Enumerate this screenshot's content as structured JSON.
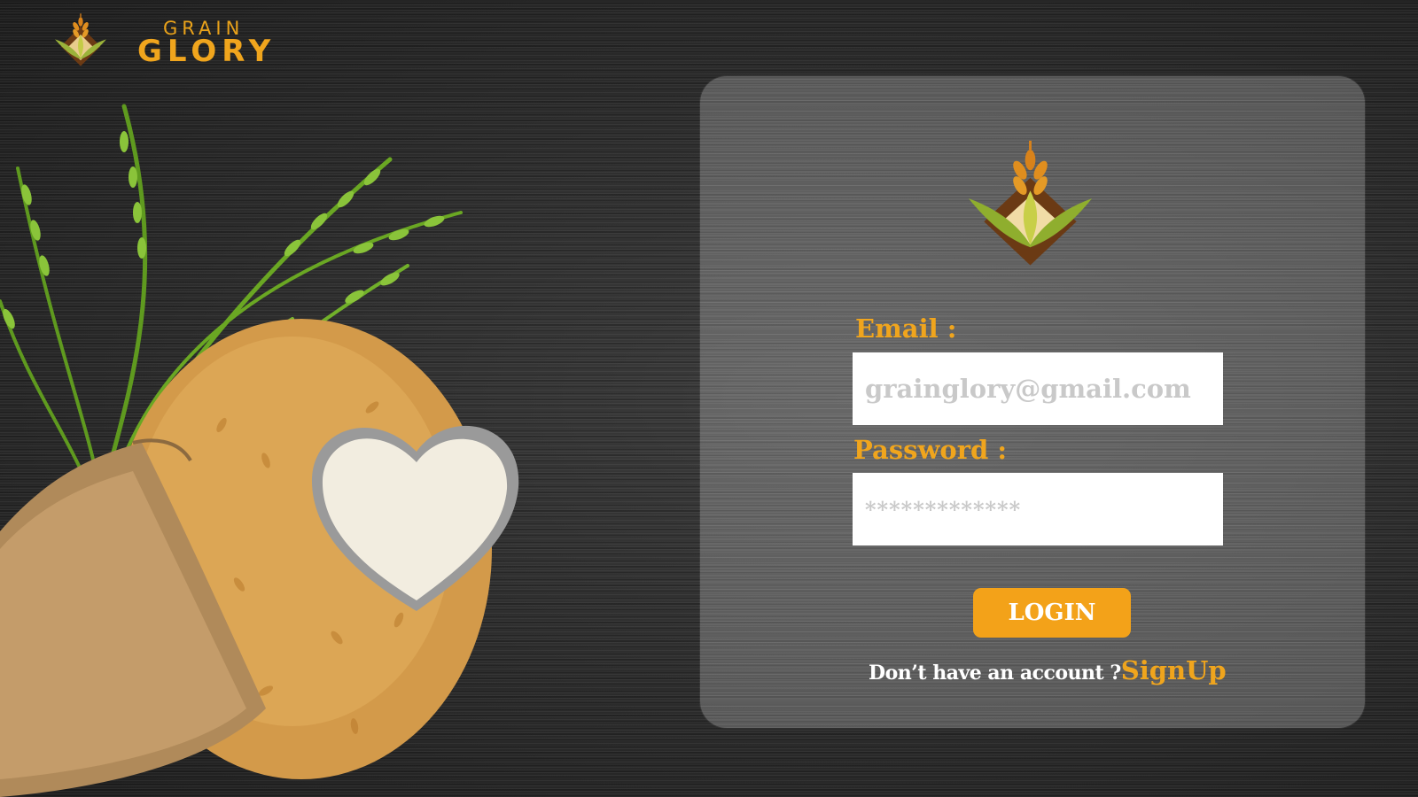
{
  "brand": {
    "word_top": "GRAIN",
    "word_bottom": "GLORY",
    "logo_icon": "wheat-diamond-logo"
  },
  "hero": {
    "image": "rice-sack-with-heart-bowl-illustration"
  },
  "login_form": {
    "logo_icon": "wheat-diamond-logo",
    "email_label": "Email :",
    "email_placeholder": "grainglory@gmail.com",
    "password_label": "Password :",
    "password_placeholder": "*************",
    "login_button": "LOGIN",
    "signup_prompt": "Don’t have an account ?",
    "signup_link": "SignUp"
  },
  "colors": {
    "accent": "#f0a51d",
    "button": "#f3a219",
    "background": "#2f2f2f",
    "card": "rgba(255,255,255,0.22)",
    "input_bg": "#ffffff",
    "placeholder": "#c9c9c9"
  }
}
